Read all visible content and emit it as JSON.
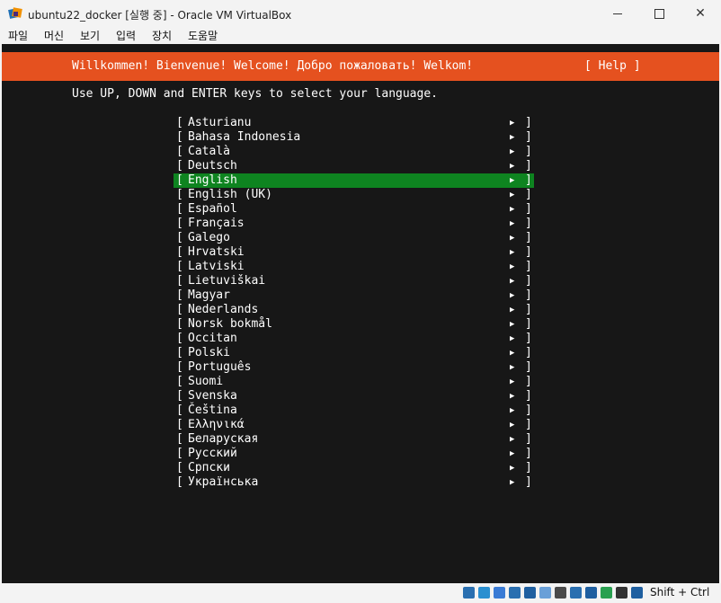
{
  "window": {
    "title": "ubuntu22_docker [실행 중] - Oracle VM VirtualBox",
    "app_icon": "virtualbox-icon",
    "controls": [
      "minimize-icon",
      "maximize-icon",
      "close-icon"
    ]
  },
  "menu": [
    "파일",
    "머신",
    "보기",
    "입력",
    "장치",
    "도움말"
  ],
  "installer": {
    "banner": "Willkommen! Bienvenue! Welcome! Добро пожаловать! Welkom!",
    "help": "[ Help ]",
    "instruction": "Use UP, DOWN and ENTER keys to select your language.",
    "selected_language": "English",
    "languages": [
      "Asturianu",
      "Bahasa Indonesia",
      "Català",
      "Deutsch",
      "English",
      "English (UK)",
      "Español",
      "Français",
      "Galego",
      "Hrvatski",
      "Latviski",
      "Lietuviškai",
      "Magyar",
      "Nederlands",
      "Norsk bokmål",
      "Occitan",
      "Polski",
      "Português",
      "Suomi",
      "Svenska",
      "Čeština",
      "Ελληνικά",
      "Беларуская",
      "Русский",
      "Српски",
      "Українська"
    ],
    "bracket_left": "[",
    "bracket_right": "]",
    "arrow": "▶"
  },
  "statusbar": {
    "icons": [
      "hard-disk-icon",
      "optical-drive-icon",
      "audio-icon",
      "network-icon",
      "usb-icon",
      "shared-folder-icon",
      "display-icon",
      "video-capture-icon",
      "virtualization-icon",
      "cpu-icon",
      "mouse-integration-icon",
      "keyboard-icon"
    ],
    "host_key": "Shift + Ctrl"
  },
  "colors": {
    "banner": "#e5511f",
    "selection": "#0e8420",
    "terminal_bg": "#171717",
    "text": "#ffffff"
  }
}
